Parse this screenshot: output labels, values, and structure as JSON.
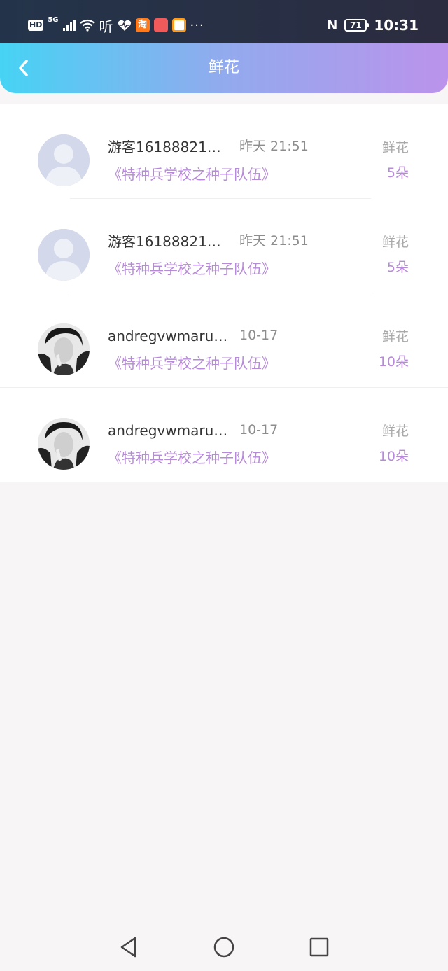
{
  "status_bar": {
    "hd": "HD",
    "network": "5G",
    "ting": "听",
    "app_icons": [
      {
        "name": "taobao-icon",
        "glyph": "淘",
        "color": "#ff7a1a"
      },
      {
        "name": "red-app-icon",
        "glyph": "",
        "color": "#f05a5a"
      },
      {
        "name": "orange-app-icon",
        "glyph": "",
        "color": "#ff9a1a"
      }
    ],
    "more": "···",
    "nfc": "N",
    "battery": "71",
    "time": "10:31"
  },
  "header": {
    "title": "鲜花"
  },
  "gifts": [
    {
      "username": "游客16188821…",
      "time": "昨天 21:51",
      "book": "《特种兵学校之种子队伍》",
      "gift_label": "鲜花",
      "count": "5朵",
      "avatar": "default"
    },
    {
      "username": "游客16188821…",
      "time": "昨天 21:51",
      "book": "《特种兵学校之种子队伍》",
      "gift_label": "鲜花",
      "count": "5朵",
      "avatar": "default"
    },
    {
      "username": "andregvwmaru…",
      "time": "10-17",
      "book": "《特种兵学校之种子队伍》",
      "gift_label": "鲜花",
      "count": "10朵",
      "avatar": "photo"
    },
    {
      "username": "andregvwmaru…",
      "time": "10-17",
      "book": "《特种兵学校之种子队伍》",
      "gift_label": "鲜花",
      "count": "10朵",
      "avatar": "photo"
    }
  ],
  "colors": {
    "header_gradient": [
      "#46d3f4",
      "#bb93eb"
    ],
    "accent_purple": "#b68ad8",
    "gray_text": "#8d8d8d"
  }
}
